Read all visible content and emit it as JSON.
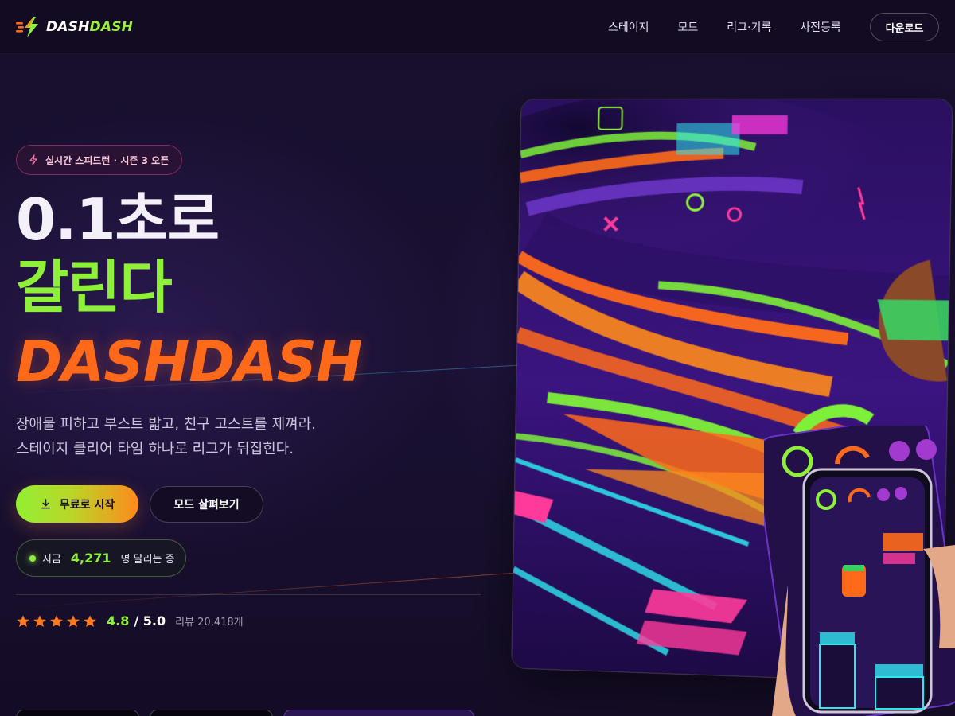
{
  "brand": {
    "name_part1": "DASH",
    "name_part2": "DASH",
    "logo_icon": "lightning-bolt-icon",
    "colors": {
      "green": "#8ff03a",
      "orange": "#ff6a1a",
      "pink": "#f0509a",
      "bg": "#150d29"
    }
  },
  "nav": {
    "links": [
      "스테이지",
      "모드",
      "리그·기록",
      "사전등록"
    ],
    "download_label": "다운로드"
  },
  "hero": {
    "badge": {
      "icon": "lightning-icon",
      "text": "실시간 스피드런 · 시즌 3 오픈"
    },
    "headline_1": "0.1초로",
    "headline_2": "갈린다",
    "headline_3": "DASHDASH",
    "description_1": "장애물 피하고 부스트 밟고, 친구 고스트를 제껴라.",
    "description_2": "스테이지 클리어 타임 하나로 리그가 뒤집힌다.",
    "primary_button": {
      "icon": "download-icon",
      "label": "무료로 시작"
    },
    "secondary_button": {
      "label": "모드 살펴보기"
    },
    "live": {
      "prefix": "지금",
      "count": "4,271",
      "suffix": "명 달리는 중"
    },
    "rating": {
      "stars": 5,
      "score": "4.8",
      "max": "/ 5.0",
      "reviews": "리뷰 20,418개"
    }
  }
}
